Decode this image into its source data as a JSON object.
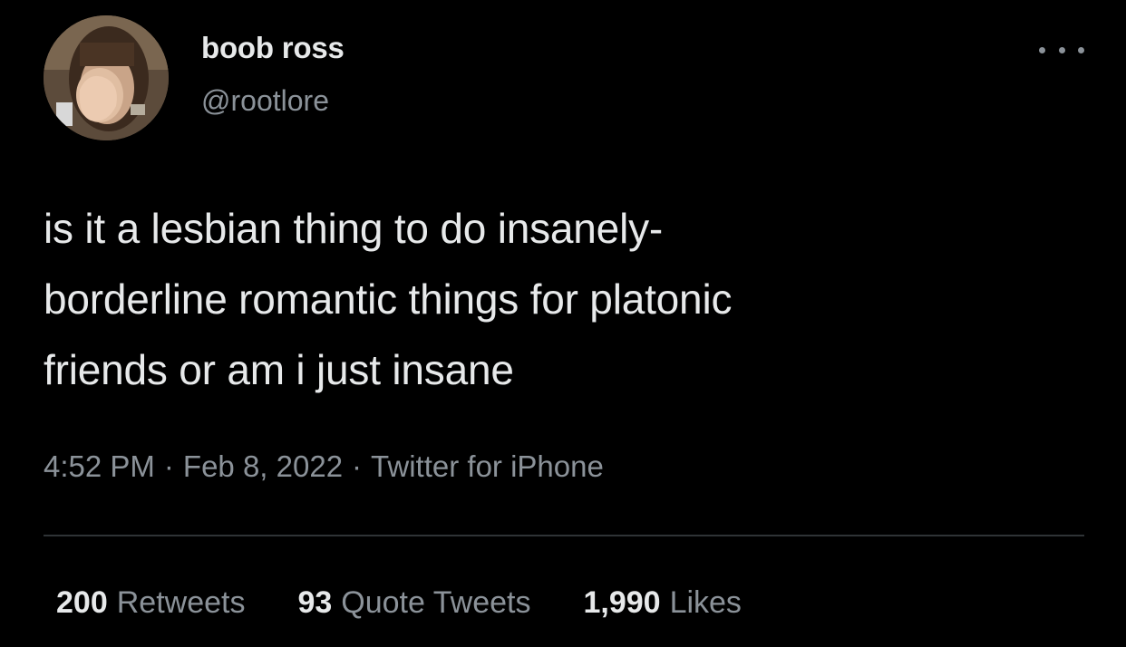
{
  "user": {
    "display_name": "boob ross",
    "handle": "@rootlore"
  },
  "tweet": {
    "text_lines": [
      "is it a lesbian thing to do insanely-",
      "borderline romantic things for platonic",
      "friends or am i just insane"
    ],
    "time": "4:52 PM",
    "date": "Feb 8, 2022",
    "source": "Twitter for iPhone",
    "separator": "·"
  },
  "stats": {
    "retweets": {
      "count": "200",
      "label": "Retweets"
    },
    "quote_tweets": {
      "count": "93",
      "label": "Quote Tweets"
    },
    "likes": {
      "count": "1,990",
      "label": "Likes"
    }
  },
  "icons": {
    "more": "more-horizontal-icon",
    "avatar": "profile-photo"
  },
  "colors": {
    "background": "#000000",
    "primary_text": "#e7e9ea",
    "secondary_text": "#8b9299",
    "divider": "#2f3336"
  }
}
